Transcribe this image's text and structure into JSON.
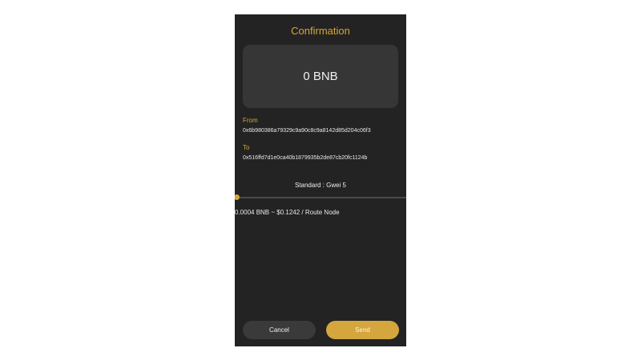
{
  "header": {
    "title": "Confirmation"
  },
  "amount": {
    "display": "0 BNB"
  },
  "from": {
    "label": "From",
    "address": "0x6b980386a79329c9a90c8c9a8142d85d204c06f3"
  },
  "to": {
    "label": "To",
    "address": "0x516ffd7d1e0ca40b1879935b2de87cb20fc1124b"
  },
  "fee": {
    "level_label": "Standard : Gwei 5",
    "slider_level": 0,
    "estimate": "0.0004 BNB ~ $0.1242 / Route Node"
  },
  "actions": {
    "cancel_label": "Cancel",
    "send_label": "Send"
  },
  "colors": {
    "accent": "#d6a63a",
    "panel_bg": "#232323",
    "card_bg": "#363636"
  }
}
